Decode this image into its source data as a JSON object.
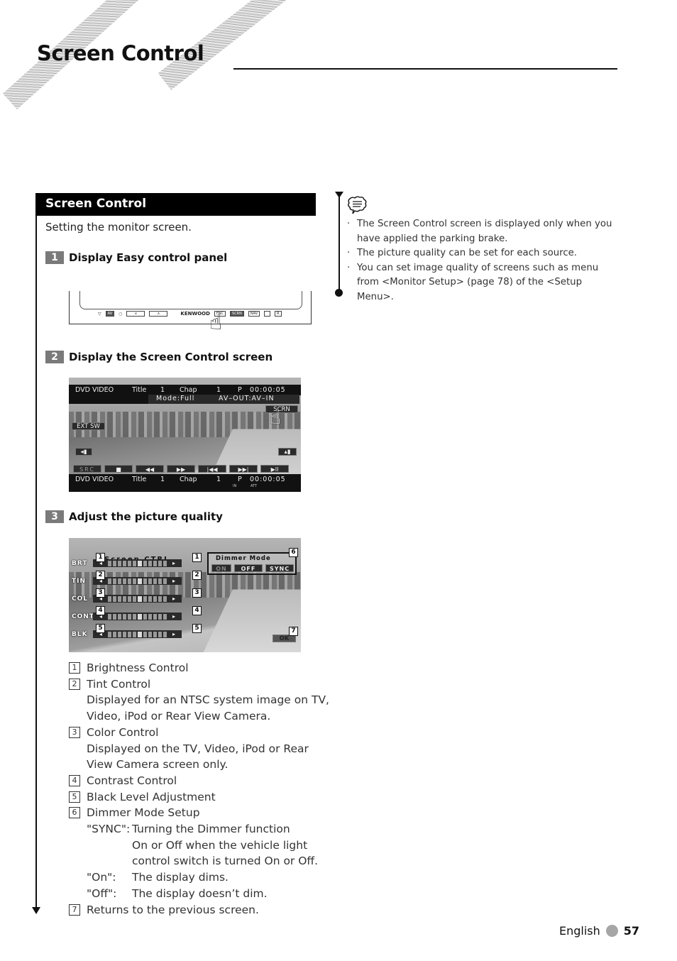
{
  "header": {
    "title": "Screen Control"
  },
  "section": {
    "heading": "Screen Control",
    "intro": "Setting the monitor screen.",
    "steps": [
      {
        "number": "1",
        "label": "Display Easy control panel"
      },
      {
        "number": "2",
        "label": "Display the Screen Control screen"
      },
      {
        "number": "3",
        "label": "Adjust the picture quality"
      }
    ]
  },
  "easy_panel": {
    "brand": "KENWOOD",
    "buttons": [
      "▽",
      "AV",
      "○",
      "∨",
      "∧",
      "FNC",
      "SCRN",
      "NAV",
      "",
      "R"
    ]
  },
  "playback_screen": {
    "top_bar": {
      "source": "DVD VIDEO",
      "title_label": "Title",
      "title_num": "1",
      "chap_label": "Chap",
      "chap_num": "1",
      "p": "P",
      "time": "00:00:05"
    },
    "mode_bar": {
      "mode": "Mode:Full",
      "av_out": "AV–OUT:AV–IN"
    },
    "scrn_button": "SCRN",
    "ext_sw_button": "EXT SW",
    "controls": [
      "SRC",
      "■",
      "◀◀",
      "▶▶",
      "|◀◀",
      "▶▶|",
      "▶II"
    ],
    "bottom_bar": {
      "source": "DVD VIDEO",
      "title_label": "Title",
      "title_num": "1",
      "chap_label": "Chap",
      "chap_num": "1",
      "p": "P",
      "time": "00:00:05"
    },
    "indicators": [
      "IN",
      "ATT"
    ]
  },
  "screen_ctrl": {
    "title": "Screen CTRL",
    "sliders": [
      {
        "label": "BRT",
        "callout": "1",
        "level": 0.5
      },
      {
        "label": "TIN",
        "callout": "2",
        "level": 0.5
      },
      {
        "label": "COL",
        "callout": "3",
        "level": 0.5
      },
      {
        "label": "CONT",
        "callout": "4",
        "level": 0.5
      },
      {
        "label": "BLK",
        "callout": "5",
        "level": 0.5
      }
    ],
    "dimmer": {
      "title": "Dimmer  Mode",
      "callout": "6",
      "options": [
        "ON",
        "OFF",
        "SYNC"
      ],
      "selected": "ON"
    },
    "ok": {
      "label": "OK",
      "callout": "7"
    }
  },
  "legend": [
    {
      "num": "1",
      "title": "Brightness Control"
    },
    {
      "num": "2",
      "title": "Tint Control",
      "desc": [
        "Displayed for an NTSC system image on TV,",
        "Video, iPod or Rear View Camera."
      ]
    },
    {
      "num": "3",
      "title": "Color Control",
      "desc": [
        "Displayed on the TV, Video, iPod or Rear",
        "View Camera screen only."
      ]
    },
    {
      "num": "4",
      "title": "Contrast Control"
    },
    {
      "num": "5",
      "title": "Black Level Adjustment"
    },
    {
      "num": "6",
      "title": "Dimmer Mode Setup",
      "defs": [
        {
          "key": "\"SYNC\":",
          "lines": [
            "Turning the Dimmer function",
            "On or Off when the vehicle light",
            "control switch is turned On or Off."
          ]
        },
        {
          "key": "\"On\":",
          "lines": [
            "The display dims."
          ]
        },
        {
          "key": "\"Off\":",
          "lines": [
            "The display doesn’t dim."
          ]
        }
      ]
    },
    {
      "num": "7",
      "title": "Returns to the previous screen."
    }
  ],
  "notes": {
    "icon": "note-speech-icon",
    "items": [
      "The Screen Control screen is displayed only when you have applied the parking brake.",
      "The picture quality can be set for each source.",
      "You can set image quality of screens such as menu from <Monitor Setup> (page 78) of the <Setup Menu>."
    ]
  },
  "footer": {
    "language": "English",
    "page": "57"
  }
}
